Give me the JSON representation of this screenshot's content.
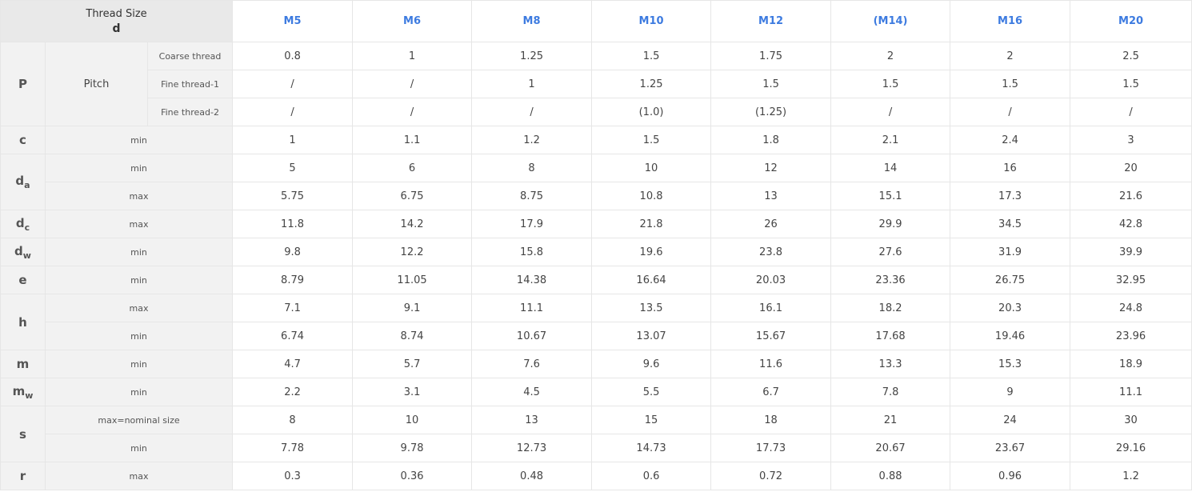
{
  "header": {
    "corner_line1": "Thread Size",
    "corner_line2": "d",
    "columns": [
      "M5",
      "M6",
      "M8",
      "M10",
      "M12",
      "(M14)",
      "M16",
      "M20"
    ]
  },
  "pitch": {
    "symbol": "P",
    "label": "Pitch",
    "rows": [
      {
        "label": "Coarse thread",
        "values": [
          "0.8",
          "1",
          "1.25",
          "1.5",
          "1.75",
          "2",
          "2",
          "2.5"
        ]
      },
      {
        "label": "Fine thread-1",
        "values": [
          "/",
          "/",
          "1",
          "1.25",
          "1.5",
          "1.5",
          "1.5",
          "1.5"
        ]
      },
      {
        "label": "Fine thread-2",
        "values": [
          "/",
          "/",
          "/",
          "(1.0)",
          "(1.25)",
          "/",
          "/",
          "/"
        ]
      }
    ]
  },
  "groups": [
    {
      "symbol": "c",
      "sub": "",
      "rows": [
        {
          "label": "min",
          "values": [
            "1",
            "1.1",
            "1.2",
            "1.5",
            "1.8",
            "2.1",
            "2.4",
            "3"
          ]
        }
      ]
    },
    {
      "symbol": "d",
      "sub": "a",
      "rows": [
        {
          "label": "min",
          "values": [
            "5",
            "6",
            "8",
            "10",
            "12",
            "14",
            "16",
            "20"
          ]
        },
        {
          "label": "max",
          "values": [
            "5.75",
            "6.75",
            "8.75",
            "10.8",
            "13",
            "15.1",
            "17.3",
            "21.6"
          ]
        }
      ]
    },
    {
      "symbol": "d",
      "sub": "c",
      "rows": [
        {
          "label": "max",
          "values": [
            "11.8",
            "14.2",
            "17.9",
            "21.8",
            "26",
            "29.9",
            "34.5",
            "42.8"
          ]
        }
      ]
    },
    {
      "symbol": "d",
      "sub": "w",
      "rows": [
        {
          "label": "min",
          "values": [
            "9.8",
            "12.2",
            "15.8",
            "19.6",
            "23.8",
            "27.6",
            "31.9",
            "39.9"
          ]
        }
      ]
    },
    {
      "symbol": "e",
      "sub": "",
      "rows": [
        {
          "label": "min",
          "values": [
            "8.79",
            "11.05",
            "14.38",
            "16.64",
            "20.03",
            "23.36",
            "26.75",
            "32.95"
          ]
        }
      ]
    },
    {
      "symbol": "h",
      "sub": "",
      "rows": [
        {
          "label": "max",
          "values": [
            "7.1",
            "9.1",
            "11.1",
            "13.5",
            "16.1",
            "18.2",
            "20.3",
            "24.8"
          ]
        },
        {
          "label": "min",
          "values": [
            "6.74",
            "8.74",
            "10.67",
            "13.07",
            "15.67",
            "17.68",
            "19.46",
            "23.96"
          ]
        }
      ]
    },
    {
      "symbol": "m",
      "sub": "",
      "rows": [
        {
          "label": "min",
          "values": [
            "4.7",
            "5.7",
            "7.6",
            "9.6",
            "11.6",
            "13.3",
            "15.3",
            "18.9"
          ]
        }
      ]
    },
    {
      "symbol": "m",
      "sub": "w",
      "rows": [
        {
          "label": "min",
          "values": [
            "2.2",
            "3.1",
            "4.5",
            "5.5",
            "6.7",
            "7.8",
            "9",
            "11.1"
          ]
        }
      ]
    },
    {
      "symbol": "s",
      "sub": "",
      "rows": [
        {
          "label": "max=nominal size",
          "values": [
            "8",
            "10",
            "13",
            "15",
            "18",
            "21",
            "24",
            "30"
          ]
        },
        {
          "label": "min",
          "values": [
            "7.78",
            "9.78",
            "12.73",
            "14.73",
            "17.73",
            "20.67",
            "23.67",
            "29.16"
          ]
        }
      ]
    },
    {
      "symbol": "r",
      "sub": "",
      "rows": [
        {
          "label": "max",
          "values": [
            "0.3",
            "0.36",
            "0.48",
            "0.6",
            "0.72",
            "0.88",
            "0.96",
            "1.2"
          ]
        }
      ]
    }
  ]
}
